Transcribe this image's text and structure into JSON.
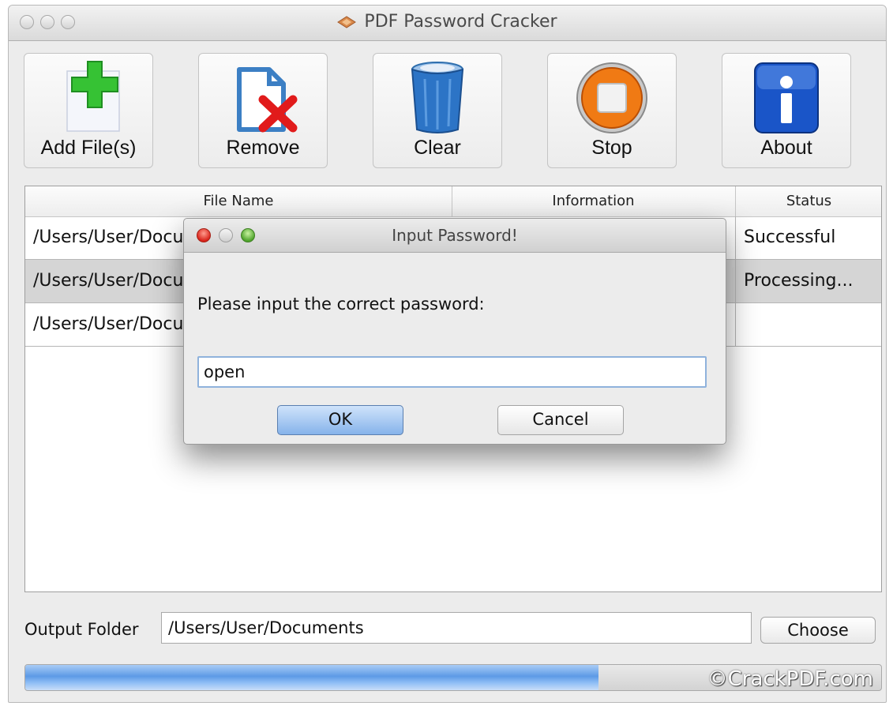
{
  "window": {
    "title": "PDF Password Cracker"
  },
  "toolbar": {
    "add_label": "Add File(s)",
    "remove_label": "Remove",
    "clear_label": "Clear",
    "stop_label": "Stop",
    "about_label": "About"
  },
  "table": {
    "columns": [
      "File Name",
      "Information",
      "Status"
    ],
    "rows": [
      {
        "file": "/Users/User/Documents",
        "status": "Successful"
      },
      {
        "file": "/Users/User/Documents",
        "status": "Processing..."
      },
      {
        "file": "/Users/User/Documents",
        "status": ""
      }
    ]
  },
  "dialog": {
    "title": "Input Password!",
    "prompt": "Please input the correct  password:",
    "value": "open",
    "ok_label": "OK",
    "cancel_label": "Cancel"
  },
  "output": {
    "label": "Output Folder",
    "path": "/Users/User/Documents",
    "choose_label": "Choose"
  },
  "progress": {
    "fraction": 0.67
  },
  "watermark": "©CrackPDF.com",
  "colors": {
    "accent": "#5d9ae6",
    "selected_row": "#d5d5d5"
  },
  "icons": [
    "add-file-icon",
    "remove-file-icon",
    "trash-icon",
    "stop-icon",
    "info-icon",
    "pdf-logo-icon"
  ]
}
